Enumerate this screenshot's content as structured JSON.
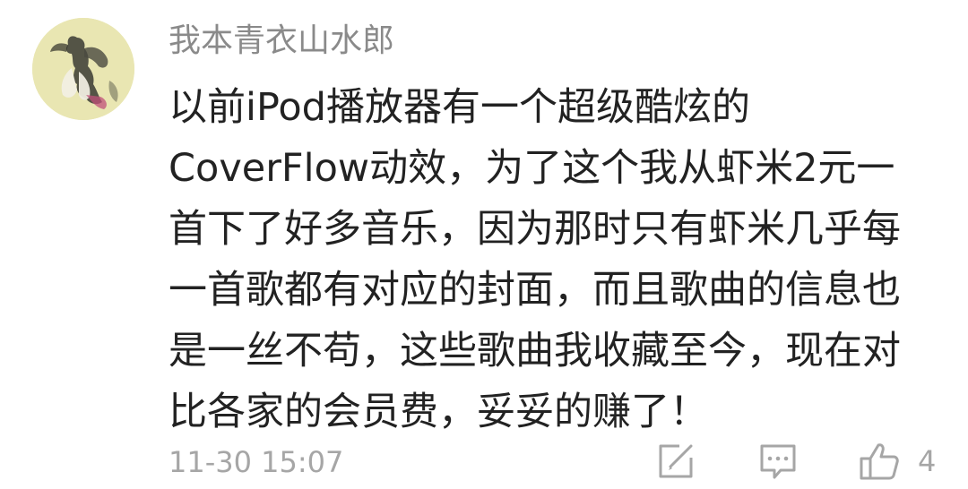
{
  "comment": {
    "username": "我本青衣山水郎",
    "content_lines": [
      "以前iPod播放器有一个超级酷炫的",
      "CoverFlow动效，为了这个我从虾米2元一",
      "首下了好多音乐，因为那时只有虾米几乎每",
      "一首歌都有对应的封面，而且歌曲的信息也",
      "是一丝不苟，这些歌曲我收藏至今，现在对",
      "比各家的会员费，妥妥的赚了！"
    ],
    "timestamp": "11-30 15:07",
    "like_count": "4",
    "avatar_icon": "ink-painting-figure-avatar",
    "actions": [
      "edit-share-icon",
      "comment-reply-icon",
      "thumbs-up-icon"
    ]
  },
  "colors": {
    "username": "#8a8a8a",
    "content": "#222222",
    "meta": "#a6a6a6",
    "avatar_bg": "#e9e6b2"
  }
}
